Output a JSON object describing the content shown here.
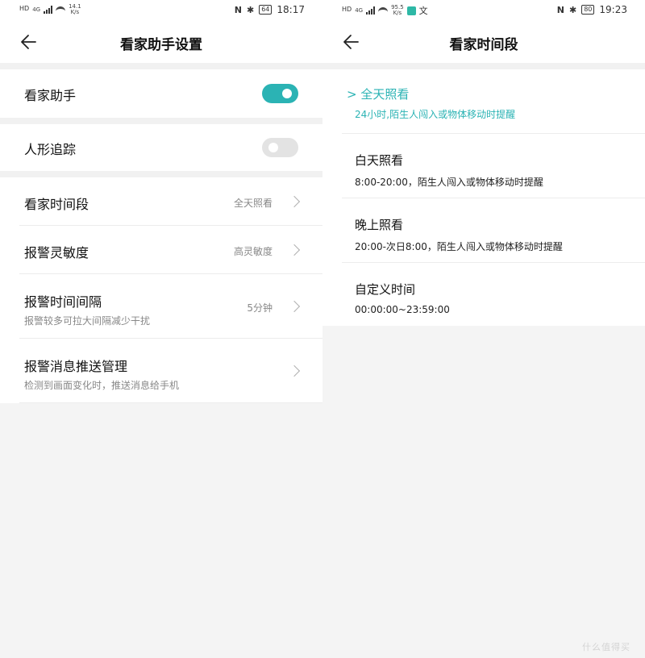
{
  "left": {
    "status": {
      "net": "4G",
      "speed": "14.1",
      "speed_unit": "K/s",
      "nfc": "N",
      "bt": "✱",
      "battery": "64",
      "time": "18:17"
    },
    "title": "看家助手设置",
    "toggles": [
      {
        "label": "看家助手",
        "on": true
      },
      {
        "label": "人形追踪",
        "on": false
      }
    ],
    "rows": [
      {
        "label": "看家时间段",
        "value": "全天照看",
        "sub": ""
      },
      {
        "label": "报警灵敏度",
        "value": "高灵敏度",
        "sub": ""
      },
      {
        "label": "报警时间间隔",
        "value": "5分钟",
        "sub": "报警较多可拉大间隔减少干扰"
      },
      {
        "label": "报警消息推送管理",
        "value": "",
        "sub": "检测到画面变化时，推送消息给手机"
      }
    ]
  },
  "right": {
    "status": {
      "net": "4G",
      "speed": "95.5",
      "speed_unit": "K/s",
      "extra": "文",
      "nfc": "N",
      "bt": "✱",
      "battery": "80",
      "time": "19:23"
    },
    "title": "看家时间段",
    "options": [
      {
        "label": "> 全天照看",
        "desc": "24小时,陌生人闯入或物体移动时提醒",
        "selected": true
      },
      {
        "label": "白天照看",
        "desc": "8:00-20:00，陌生人闯入或物体移动时提醒",
        "selected": false
      },
      {
        "label": "晚上照看",
        "desc": "20:00-次日8:00，陌生人闯入或物体移动时提醒",
        "selected": false
      },
      {
        "label": "自定义时间",
        "desc": "00:00:00~23:59:00",
        "selected": false
      }
    ]
  },
  "colors": {
    "accent": "#2bb3b4",
    "toggle_off": "#e3e3e3",
    "page_bg": "#f4f4f4"
  },
  "icons": {
    "back": "arrow-left-icon",
    "chevron": "chevron-right-icon"
  },
  "watermark": "什么值得买"
}
